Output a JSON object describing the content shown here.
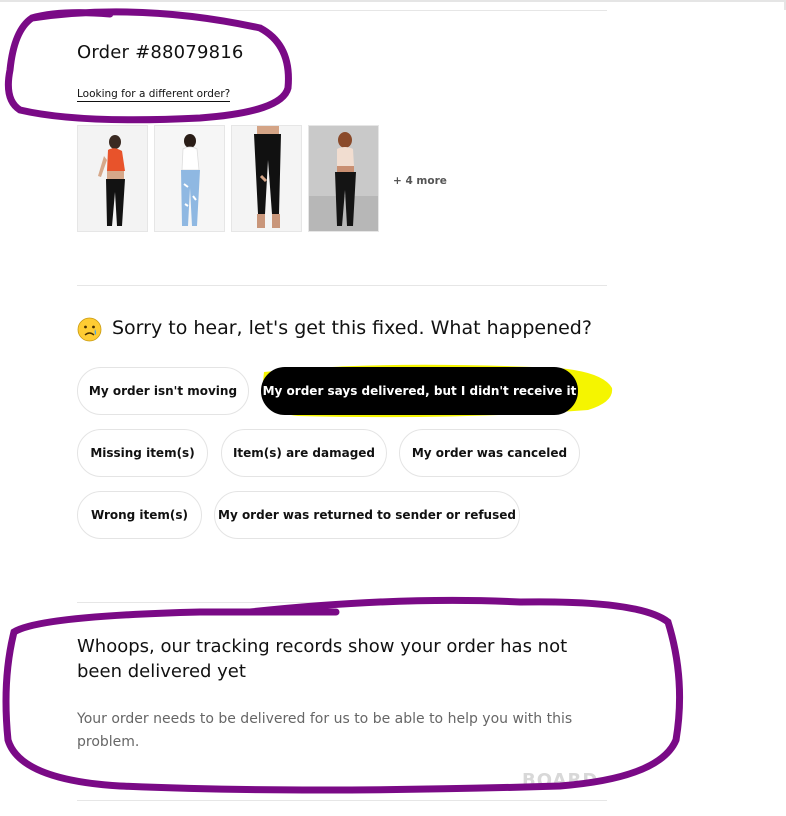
{
  "order": {
    "title": "Order #88079816",
    "different_order_link": "Looking for a different order?",
    "more_items": "+ 4 more"
  },
  "question": {
    "emoji": "sad-tear-face-icon",
    "text": "Sorry to hear, let's get this fixed. What happened?"
  },
  "options": [
    {
      "label": "My order isn't moving",
      "selected": false
    },
    {
      "label": "My order says delivered, but I didn't receive it",
      "selected": true
    },
    {
      "label": "Missing item(s)",
      "selected": false
    },
    {
      "label": "Item(s) are damaged",
      "selected": false
    },
    {
      "label": "My order was canceled",
      "selected": false
    },
    {
      "label": "Wrong item(s)",
      "selected": false
    },
    {
      "label": "My order was returned to sender or refused",
      "selected": false
    }
  ],
  "result": {
    "title": "Whoops, our tracking records show your order has not been delivered yet",
    "message": "Your order needs to be delivered for us to be able to help you with this problem."
  },
  "watermark": "BOARD",
  "colors": {
    "selected_bg": "#000000",
    "annotation_purple": "#7a0a86",
    "highlight_yellow": "#f5f500"
  }
}
